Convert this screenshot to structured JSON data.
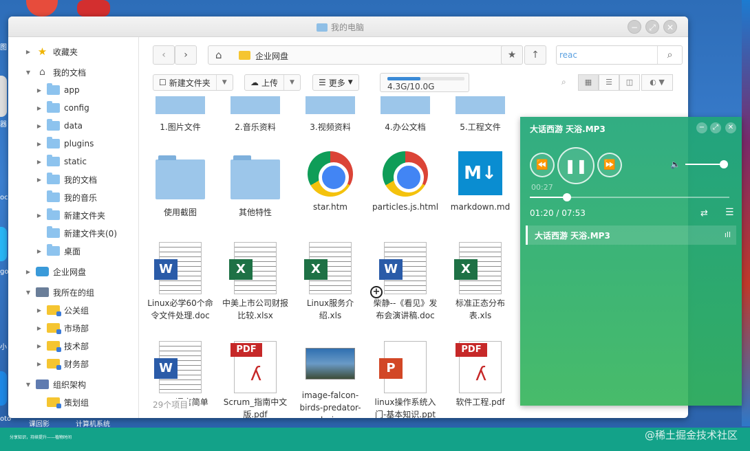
{
  "desktop": {
    "edge_labels": [
      "图",
      "器",
      "oc",
      "go",
      "小",
      "oto",
      "课回影",
      "计算机系统"
    ]
  },
  "window": {
    "title": "我的电脑"
  },
  "sidebar": {
    "items": [
      {
        "label": "收藏夹",
        "icon": "star-icon"
      },
      {
        "label": "我的文档",
        "icon": "home-icon"
      },
      {
        "label": "app",
        "icon": "folder-icon"
      },
      {
        "label": "config",
        "icon": "folder-icon"
      },
      {
        "label": "data",
        "icon": "folder-icon"
      },
      {
        "label": "plugins",
        "icon": "folder-icon"
      },
      {
        "label": "static",
        "icon": "folder-icon"
      },
      {
        "label": "我的文档",
        "icon": "folder-icon"
      },
      {
        "label": "我的音乐",
        "icon": "folder-icon"
      },
      {
        "label": "新建文件夹",
        "icon": "folder-icon"
      },
      {
        "label": "新建文件夹(0)",
        "icon": "folder-icon"
      },
      {
        "label": "桌面",
        "icon": "folder-icon"
      },
      {
        "label": "企业网盘",
        "icon": "cloud-icon"
      },
      {
        "label": "我所在的组",
        "icon": "group-icon"
      },
      {
        "label": "公关组",
        "icon": "group-folder-icon"
      },
      {
        "label": "市场部",
        "icon": "group-folder-icon"
      },
      {
        "label": "技术部",
        "icon": "group-folder-icon"
      },
      {
        "label": "财务部",
        "icon": "group-folder-icon"
      },
      {
        "label": "组织架构",
        "icon": "org-icon"
      },
      {
        "label": "策划组",
        "icon": "group-folder-icon"
      }
    ]
  },
  "address": {
    "path": "企业网盘",
    "search_value": "reac"
  },
  "toolbar": {
    "new_folder": "新建文件夹",
    "upload": "上传",
    "more": "更多",
    "quota_text": "4.3G/10.0G",
    "quota_used": 0.43
  },
  "files": [
    {
      "name": "1.图片文件",
      "type": "folder-cut"
    },
    {
      "name": "2.音乐资料",
      "type": "folder-cut"
    },
    {
      "name": "3.视频资料",
      "type": "folder-cut"
    },
    {
      "name": "4.办公文档",
      "type": "folder-cut"
    },
    {
      "name": "5.工程文件",
      "type": "folder-cut"
    },
    {
      "name": "使用截图",
      "type": "folder"
    },
    {
      "name": "其他特性",
      "type": "folder"
    },
    {
      "name": "star.htm",
      "type": "chrome"
    },
    {
      "name": "particles.js.html",
      "type": "chrome"
    },
    {
      "name": "markdown.md",
      "type": "md"
    },
    {
      "name": "Linux必学60个命令文件处理.doc",
      "type": "word"
    },
    {
      "name": "中美上市公司财报比较.xlsx",
      "type": "excel"
    },
    {
      "name": "Linux服务介绍.xls",
      "type": "excel"
    },
    {
      "name": "柴静--《看见》发布会演讲稿.doc",
      "type": "word"
    },
    {
      "name": "标准正态分布表.xls",
      "type": "excel"
    },
    {
      "name": "HTML语言简单",
      "type": "word"
    },
    {
      "name": "Scrum_指南中文版.pdf",
      "type": "pdf"
    },
    {
      "name": "image-falcon-birds-predator-sky.jpg",
      "type": "photo"
    },
    {
      "name": "linux操作系统入门-基本知识.ppt",
      "type": "ppt"
    },
    {
      "name": "软件工程.pdf",
      "type": "pdf"
    }
  ],
  "status": {
    "item_count": "29个项目"
  },
  "player": {
    "title": "大话西游 天浴.MP3",
    "elapsed_small": "00:27",
    "time": "01:20 / 07:53",
    "progress": 0.17,
    "volume": 0.9,
    "playlist": [
      "大话西游 天浴.MP3"
    ]
  },
  "footer": {
    "slogan": "分享知识，持续提升——植物时间",
    "watermark": "@稀土掘金技术社区"
  }
}
